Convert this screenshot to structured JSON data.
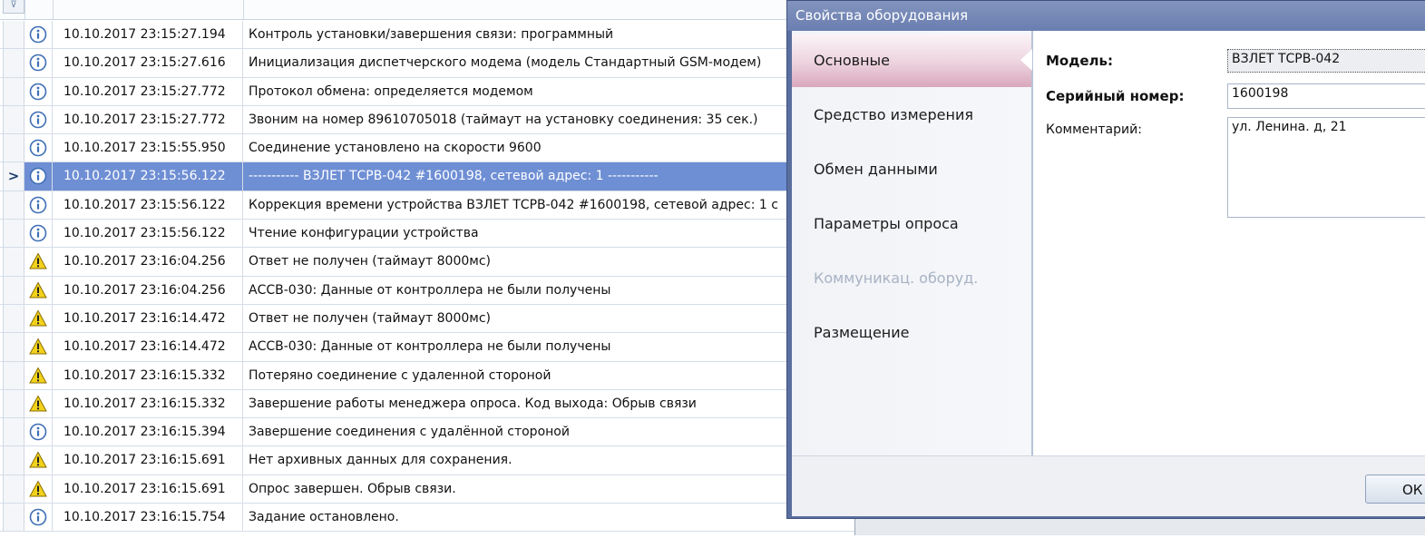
{
  "grid": {
    "rows": [
      {
        "type": "info",
        "time": "10.10.2017 23:15:27.194",
        "message": "Контроль установки/завершения связи: программный",
        "selected": false,
        "indicator": ""
      },
      {
        "type": "info",
        "time": "10.10.2017 23:15:27.616",
        "message": "Инициализация диспетчерского модема (модель Стандартный GSM-модем)",
        "selected": false,
        "indicator": ""
      },
      {
        "type": "info",
        "time": "10.10.2017 23:15:27.772",
        "message": "Протокол обмена: определяется модемом",
        "selected": false,
        "indicator": ""
      },
      {
        "type": "info",
        "time": "10.10.2017 23:15:27.772",
        "message": "Звоним на номер 89610705018 (таймаут на установку соединения: 35 сек.)",
        "selected": false,
        "indicator": ""
      },
      {
        "type": "info",
        "time": "10.10.2017 23:15:55.950",
        "message": "Соединение установлено на скорости 9600",
        "selected": false,
        "indicator": ""
      },
      {
        "type": "info",
        "time": "10.10.2017 23:15:56.122",
        "message": "----------- ВЗЛЕТ ТСРВ-042 #1600198, сетевой адрес: 1 -----------",
        "selected": true,
        "indicator": ">"
      },
      {
        "type": "info",
        "time": "10.10.2017 23:15:56.122",
        "message": "Коррекция времени устройства ВЗЛЕТ ТСРВ-042 #1600198, сетевой адрес: 1 с",
        "selected": false,
        "indicator": ""
      },
      {
        "type": "info",
        "time": "10.10.2017 23:15:56.122",
        "message": "Чтение конфигурации устройства",
        "selected": false,
        "indicator": ""
      },
      {
        "type": "warning",
        "time": "10.10.2017 23:16:04.256",
        "message": "Ответ не получен (таймаут 8000мс)",
        "selected": false,
        "indicator": ""
      },
      {
        "type": "warning",
        "time": "10.10.2017 23:16:04.256",
        "message": "АССВ-030: Данные от контроллера не были получены",
        "selected": false,
        "indicator": ""
      },
      {
        "type": "warning",
        "time": "10.10.2017 23:16:14.472",
        "message": "Ответ не получен (таймаут 8000мс)",
        "selected": false,
        "indicator": ""
      },
      {
        "type": "warning",
        "time": "10.10.2017 23:16:14.472",
        "message": "АССВ-030: Данные от контроллера не были получены",
        "selected": false,
        "indicator": ""
      },
      {
        "type": "warning",
        "time": "10.10.2017 23:16:15.332",
        "message": "Потеряно соединение с удаленной стороной",
        "selected": false,
        "indicator": ""
      },
      {
        "type": "warning",
        "time": "10.10.2017 23:16:15.332",
        "message": "Завершение работы менеджера опроса. Код выхода: Обрыв связи",
        "selected": false,
        "indicator": ""
      },
      {
        "type": "info",
        "time": "10.10.2017 23:16:15.394",
        "message": "Завершение соединения с удалённой стороной",
        "selected": false,
        "indicator": ""
      },
      {
        "type": "warning",
        "time": "10.10.2017 23:16:15.691",
        "message": "Нет архивных данных для сохранения.",
        "selected": false,
        "indicator": ""
      },
      {
        "type": "warning",
        "time": "10.10.2017 23:16:15.691",
        "message": "Опрос завершен. Обрыв связи.",
        "selected": false,
        "indicator": ""
      },
      {
        "type": "info",
        "time": "10.10.2017 23:16:15.754",
        "message": "Задание остановлено.",
        "selected": false,
        "indicator": ""
      }
    ]
  },
  "dialog": {
    "title": "Свойства оборудования",
    "nav": [
      {
        "label": "Основные",
        "state": "active"
      },
      {
        "label": "Средство измерения",
        "state": "normal"
      },
      {
        "label": "Обмен данными",
        "state": "normal"
      },
      {
        "label": "Параметры опроса",
        "state": "normal"
      },
      {
        "label": "Коммуникац. оборуд.",
        "state": "disabled"
      },
      {
        "label": "Размещение",
        "state": "normal"
      }
    ],
    "fields": {
      "model_label": "Модель:",
      "model_value": "ВЗЛЕТ ТСРВ-042",
      "serial_label": "Серийный номер:",
      "serial_value": "1600198",
      "comment_label": "Комментарий:",
      "comment_value": "ул. Ленина. д, 21"
    },
    "ok_label": "ОК"
  },
  "colors": {
    "selected_row": "#6f8fd4",
    "title_bar": "#7486b6",
    "info_icon": "#3f6fb6",
    "warning_icon": "#f2d21b"
  },
  "icons": {
    "info": "info-icon",
    "warning": "warning-icon"
  }
}
